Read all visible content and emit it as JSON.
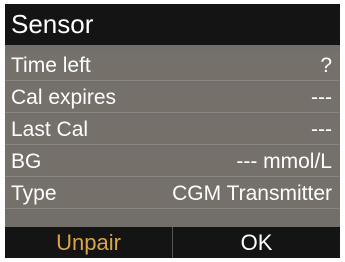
{
  "header": {
    "title": "Sensor"
  },
  "rows": [
    {
      "label": "Time left",
      "value": "?"
    },
    {
      "label": "Cal expires",
      "value": "---"
    },
    {
      "label": "Last Cal",
      "value": "---"
    },
    {
      "label": "BG",
      "value": "--- mmol/L"
    },
    {
      "label": "Type",
      "value": "CGM Transmitter"
    }
  ],
  "softkeys": {
    "left_label": "Unpair",
    "right_label": "OK"
  },
  "colors": {
    "title_bg": "#141414",
    "body_bg": "#726e6a",
    "accent_left_softkey": "#d9a53c",
    "text": "#ffffff"
  }
}
